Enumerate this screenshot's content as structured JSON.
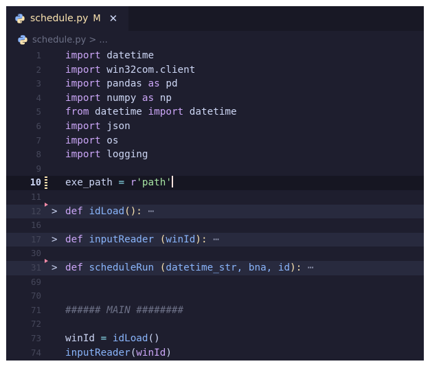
{
  "tab": {
    "filename": "schedule.py",
    "status": "M",
    "close_glyph": "✕",
    "icon": "python-icon"
  },
  "breadcrumb": {
    "file": "schedule.py",
    "separator": "> ..."
  },
  "editor": {
    "active_line": "10",
    "lines": [
      {
        "num": "1",
        "kw1": "import",
        "rest": " datetime"
      },
      {
        "num": "2",
        "kw1": "import",
        "rest": " win32com.client"
      },
      {
        "num": "3",
        "kw1": "import",
        "rest": " pandas ",
        "kw2": "as",
        "rest2": " pd"
      },
      {
        "num": "4",
        "kw1": "import",
        "rest": " numpy ",
        "kw2": "as",
        "rest2": " np"
      },
      {
        "num": "5",
        "kw1": "from",
        "rest": " datetime ",
        "kw2": "import",
        "rest2": " datetime"
      },
      {
        "num": "6",
        "kw1": "import",
        "rest": " json"
      },
      {
        "num": "7",
        "kw1": "import",
        "rest": " os"
      },
      {
        "num": "8",
        "kw1": "import",
        "rest": " logging"
      },
      {
        "num": "9"
      },
      {
        "num": "10",
        "var": "exe_path",
        "op": " = ",
        "prefix": "r",
        "str": "'path'"
      },
      {
        "num": "11"
      },
      {
        "num": "12",
        "def": "def",
        "fname": "idLoad",
        "params": "",
        "tail": "():",
        "ellipsis": " ⋯"
      },
      {
        "num": "16"
      },
      {
        "num": "17",
        "def": "def",
        "fname": "inputReader",
        "params": "winId",
        "ellipsis": " ⋯"
      },
      {
        "num": "30"
      },
      {
        "num": "31",
        "def": "def",
        "fname": "scheduleRun",
        "params": "datetime_str, bna, id",
        "ellipsis": " ⋯"
      },
      {
        "num": "69"
      },
      {
        "num": "70"
      },
      {
        "num": "71",
        "comment": "###### MAIN ########"
      },
      {
        "num": "72"
      },
      {
        "num": "73",
        "var": "winId",
        "op": " = ",
        "call": "idLoad",
        "args": "()"
      },
      {
        "num": "74",
        "call": "inputReader",
        "args_open": "(",
        "arg": "winId",
        "args_close": ")"
      }
    ]
  }
}
